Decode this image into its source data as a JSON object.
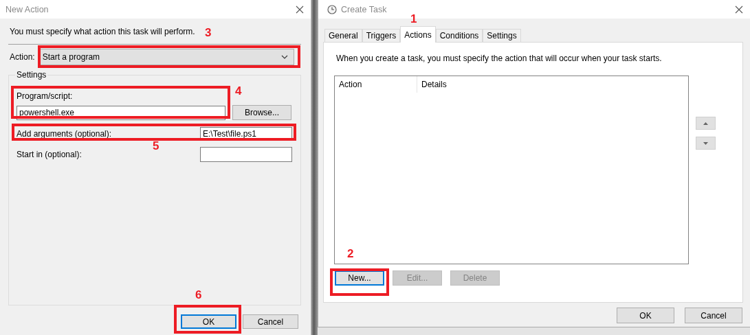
{
  "new_action_window": {
    "title": "New Action",
    "instruction": "You must specify what action this task will perform.",
    "action": {
      "label": "Action:",
      "value": "Start a program"
    },
    "settings": {
      "legend": "Settings",
      "program": {
        "label": "Program/script:",
        "value": "powershell.exe",
        "browse_button": "Browse..."
      },
      "arguments": {
        "label": "Add arguments (optional):",
        "value": "E:\\Test\\file.ps1"
      },
      "start_in": {
        "label": "Start in (optional):"
      }
    },
    "buttons": [
      {
        "label": "OK",
        "focused": true
      },
      {
        "label": "Cancel",
        "focused": false
      }
    ]
  },
  "create_task_window": {
    "title": "Create Task",
    "tabs": [
      {
        "label": "General",
        "selected": false
      },
      {
        "label": "Triggers",
        "selected": false
      },
      {
        "label": "Actions",
        "selected": true
      },
      {
        "label": "Conditions",
        "selected": false
      },
      {
        "label": "Settings",
        "selected": false
      }
    ],
    "description": "When you create a task, you must specify the action that will occur when your task starts.",
    "list": {
      "columns": [
        "Action",
        "Details"
      ]
    },
    "list_buttons": [
      {
        "label": "New...",
        "disabled": false,
        "focused": true
      },
      {
        "label": "Edit...",
        "disabled": true,
        "focused": false
      },
      {
        "label": "Delete",
        "disabled": true,
        "focused": false
      }
    ],
    "buttons": [
      {
        "label": "OK",
        "focused": false
      },
      {
        "label": "Cancel",
        "focused": false
      }
    ]
  },
  "annotations": [
    {
      "number": "1"
    },
    {
      "number": "2"
    },
    {
      "number": "3"
    },
    {
      "number": "4"
    },
    {
      "number": "5"
    },
    {
      "number": "6"
    }
  ]
}
